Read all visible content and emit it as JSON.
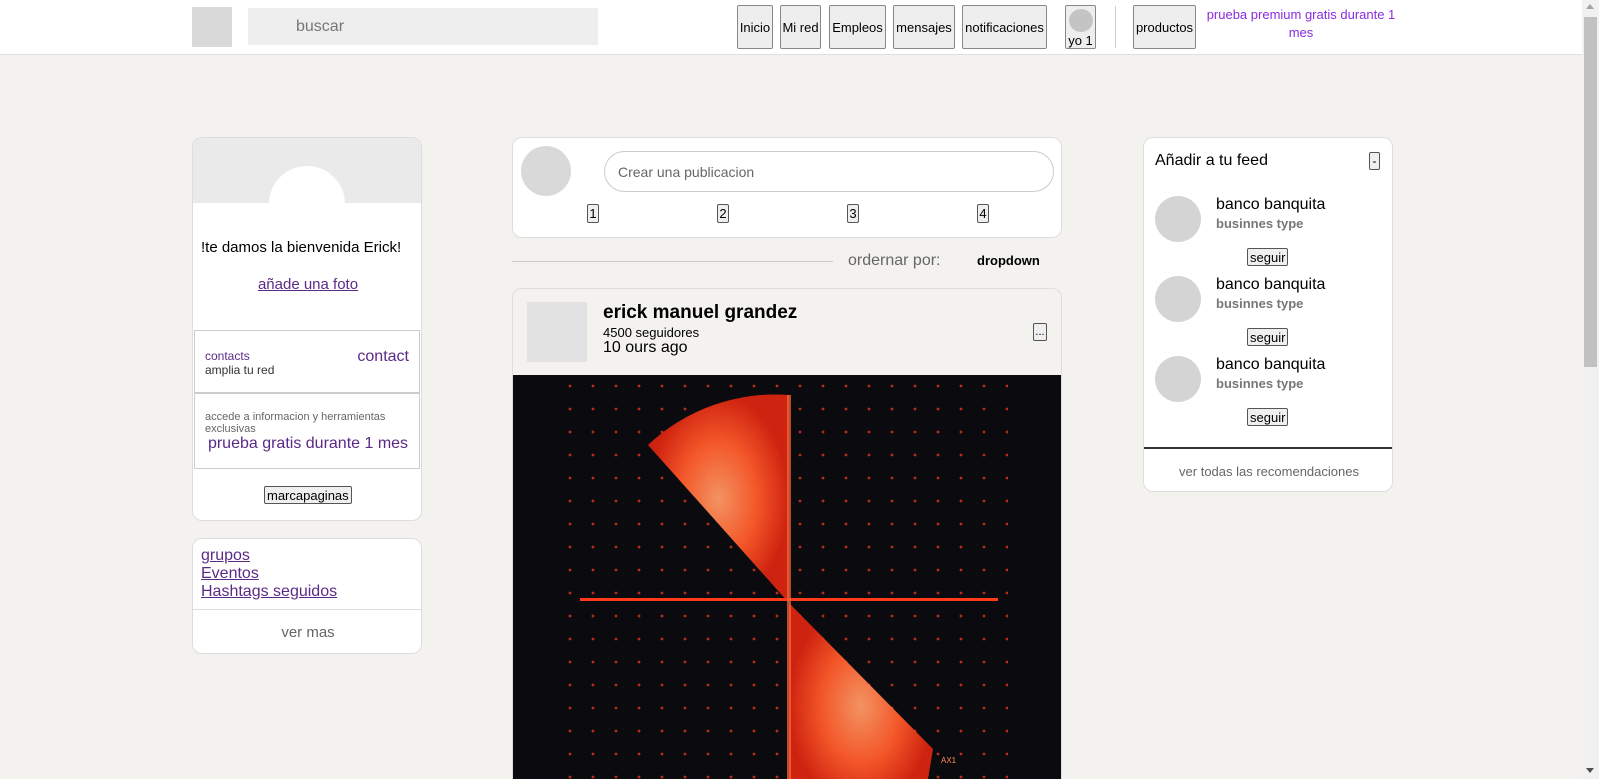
{
  "header": {
    "search_placeholder": "buscar",
    "nav": {
      "inicio": "Inicio",
      "mi_red": "Mi red",
      "empleos": "Empleos",
      "mensajes": "mensajes",
      "notificaciones": "notificaciones",
      "yo": "yo 1",
      "productos": "productos"
    },
    "premium": "prueba premium gratis durante 1 mes"
  },
  "profile": {
    "welcome": "!te damos la bienvenida Erick!",
    "add_photo": "añade una foto",
    "contacts_label": "contacts",
    "contacts_sub": "amplia tu red",
    "contact_link": "contact",
    "promo_sub": "accede a informacion y herramientas exclusivas",
    "promo_link": "prueba gratis durante 1 mes",
    "bookmarks": "marcapaginas"
  },
  "groups": {
    "links": [
      "grupos",
      "Eventos",
      "Hashtags seguidos"
    ],
    "ver_mas": "ver mas"
  },
  "create_post": {
    "placeholder": "Crear una publicacion",
    "buttons": [
      "1",
      "2",
      "3",
      "4"
    ]
  },
  "sort": {
    "label": "ordernar por:",
    "dropdown": "dropdown"
  },
  "post": {
    "author": "erick manuel grandez",
    "followers": "4500 seguidores",
    "time": "10 ours ago",
    "more": "...",
    "image_mark": "AX1"
  },
  "feed": {
    "title": "Añadir a tu feed",
    "collapse": "-",
    "recommendations": [
      {
        "name": "banco banquita",
        "type": "businnes type",
        "follow": "seguir"
      },
      {
        "name": "banco banquita",
        "type": "businnes type",
        "follow": "seguir"
      },
      {
        "name": "banco banquita",
        "type": "businnes type",
        "follow": "seguir"
      }
    ],
    "view_all": "ver todas las recomendaciones"
  },
  "colors": {
    "background": "#f3f2ef",
    "link_purple": "#5b2a86",
    "premium_purple": "#8a2be2",
    "image_red": "#ff3a1a",
    "image_orange": "#ff8a50"
  }
}
